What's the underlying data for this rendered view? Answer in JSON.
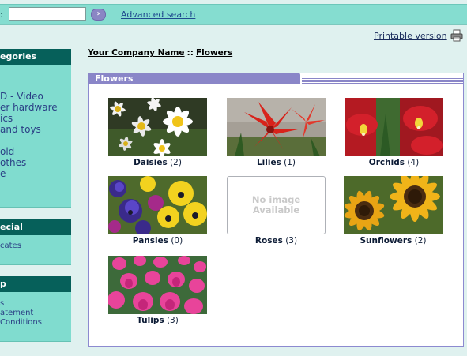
{
  "search": {
    "label": ":",
    "input_value": "",
    "go_label": "›",
    "advanced_label": "Advanced search"
  },
  "printable": {
    "label": "Printable version"
  },
  "breadcrumb": {
    "home": "Your Company Name",
    "separator": "::",
    "current": "Flowers"
  },
  "sidebar": {
    "categories": {
      "title": "egories",
      "items": [
        "",
        "",
        "D - Video",
        "er hardware",
        "ics",
        "and toys",
        "",
        "old",
        "othes",
        "e"
      ]
    },
    "specials": {
      "title": "ecial",
      "items": [
        "cates"
      ]
    },
    "information": {
      "title": "p",
      "items": [
        "s",
        "atement",
        "Conditions"
      ]
    }
  },
  "panel": {
    "title": "Flowers"
  },
  "products": [
    {
      "name": "Daisies",
      "count": "(2)",
      "image": "daisies"
    },
    {
      "name": "Lilies",
      "count": "(1)",
      "image": "lilies"
    },
    {
      "name": "Orchids",
      "count": "(4)",
      "image": "orchids"
    },
    {
      "name": "Pansies",
      "count": "(0)",
      "image": "pansies"
    },
    {
      "name": "Roses",
      "count": "(3)",
      "image": "none",
      "placeholder_line1": "No image",
      "placeholder_line2": "Available"
    },
    {
      "name": "Sunflowers",
      "count": "(2)",
      "image": "sunflowers"
    },
    {
      "name": "Tulips",
      "count": "(3)",
      "image": "tulips"
    }
  ],
  "colors": {
    "page_bg": "#dff1ef",
    "topbar_bg": "#85ddd0",
    "sidebar_bg": "#80dccf",
    "sidebar_head_bg": "#06605a",
    "panel_accent": "#8a86c8",
    "link": "#1f4a8e"
  }
}
